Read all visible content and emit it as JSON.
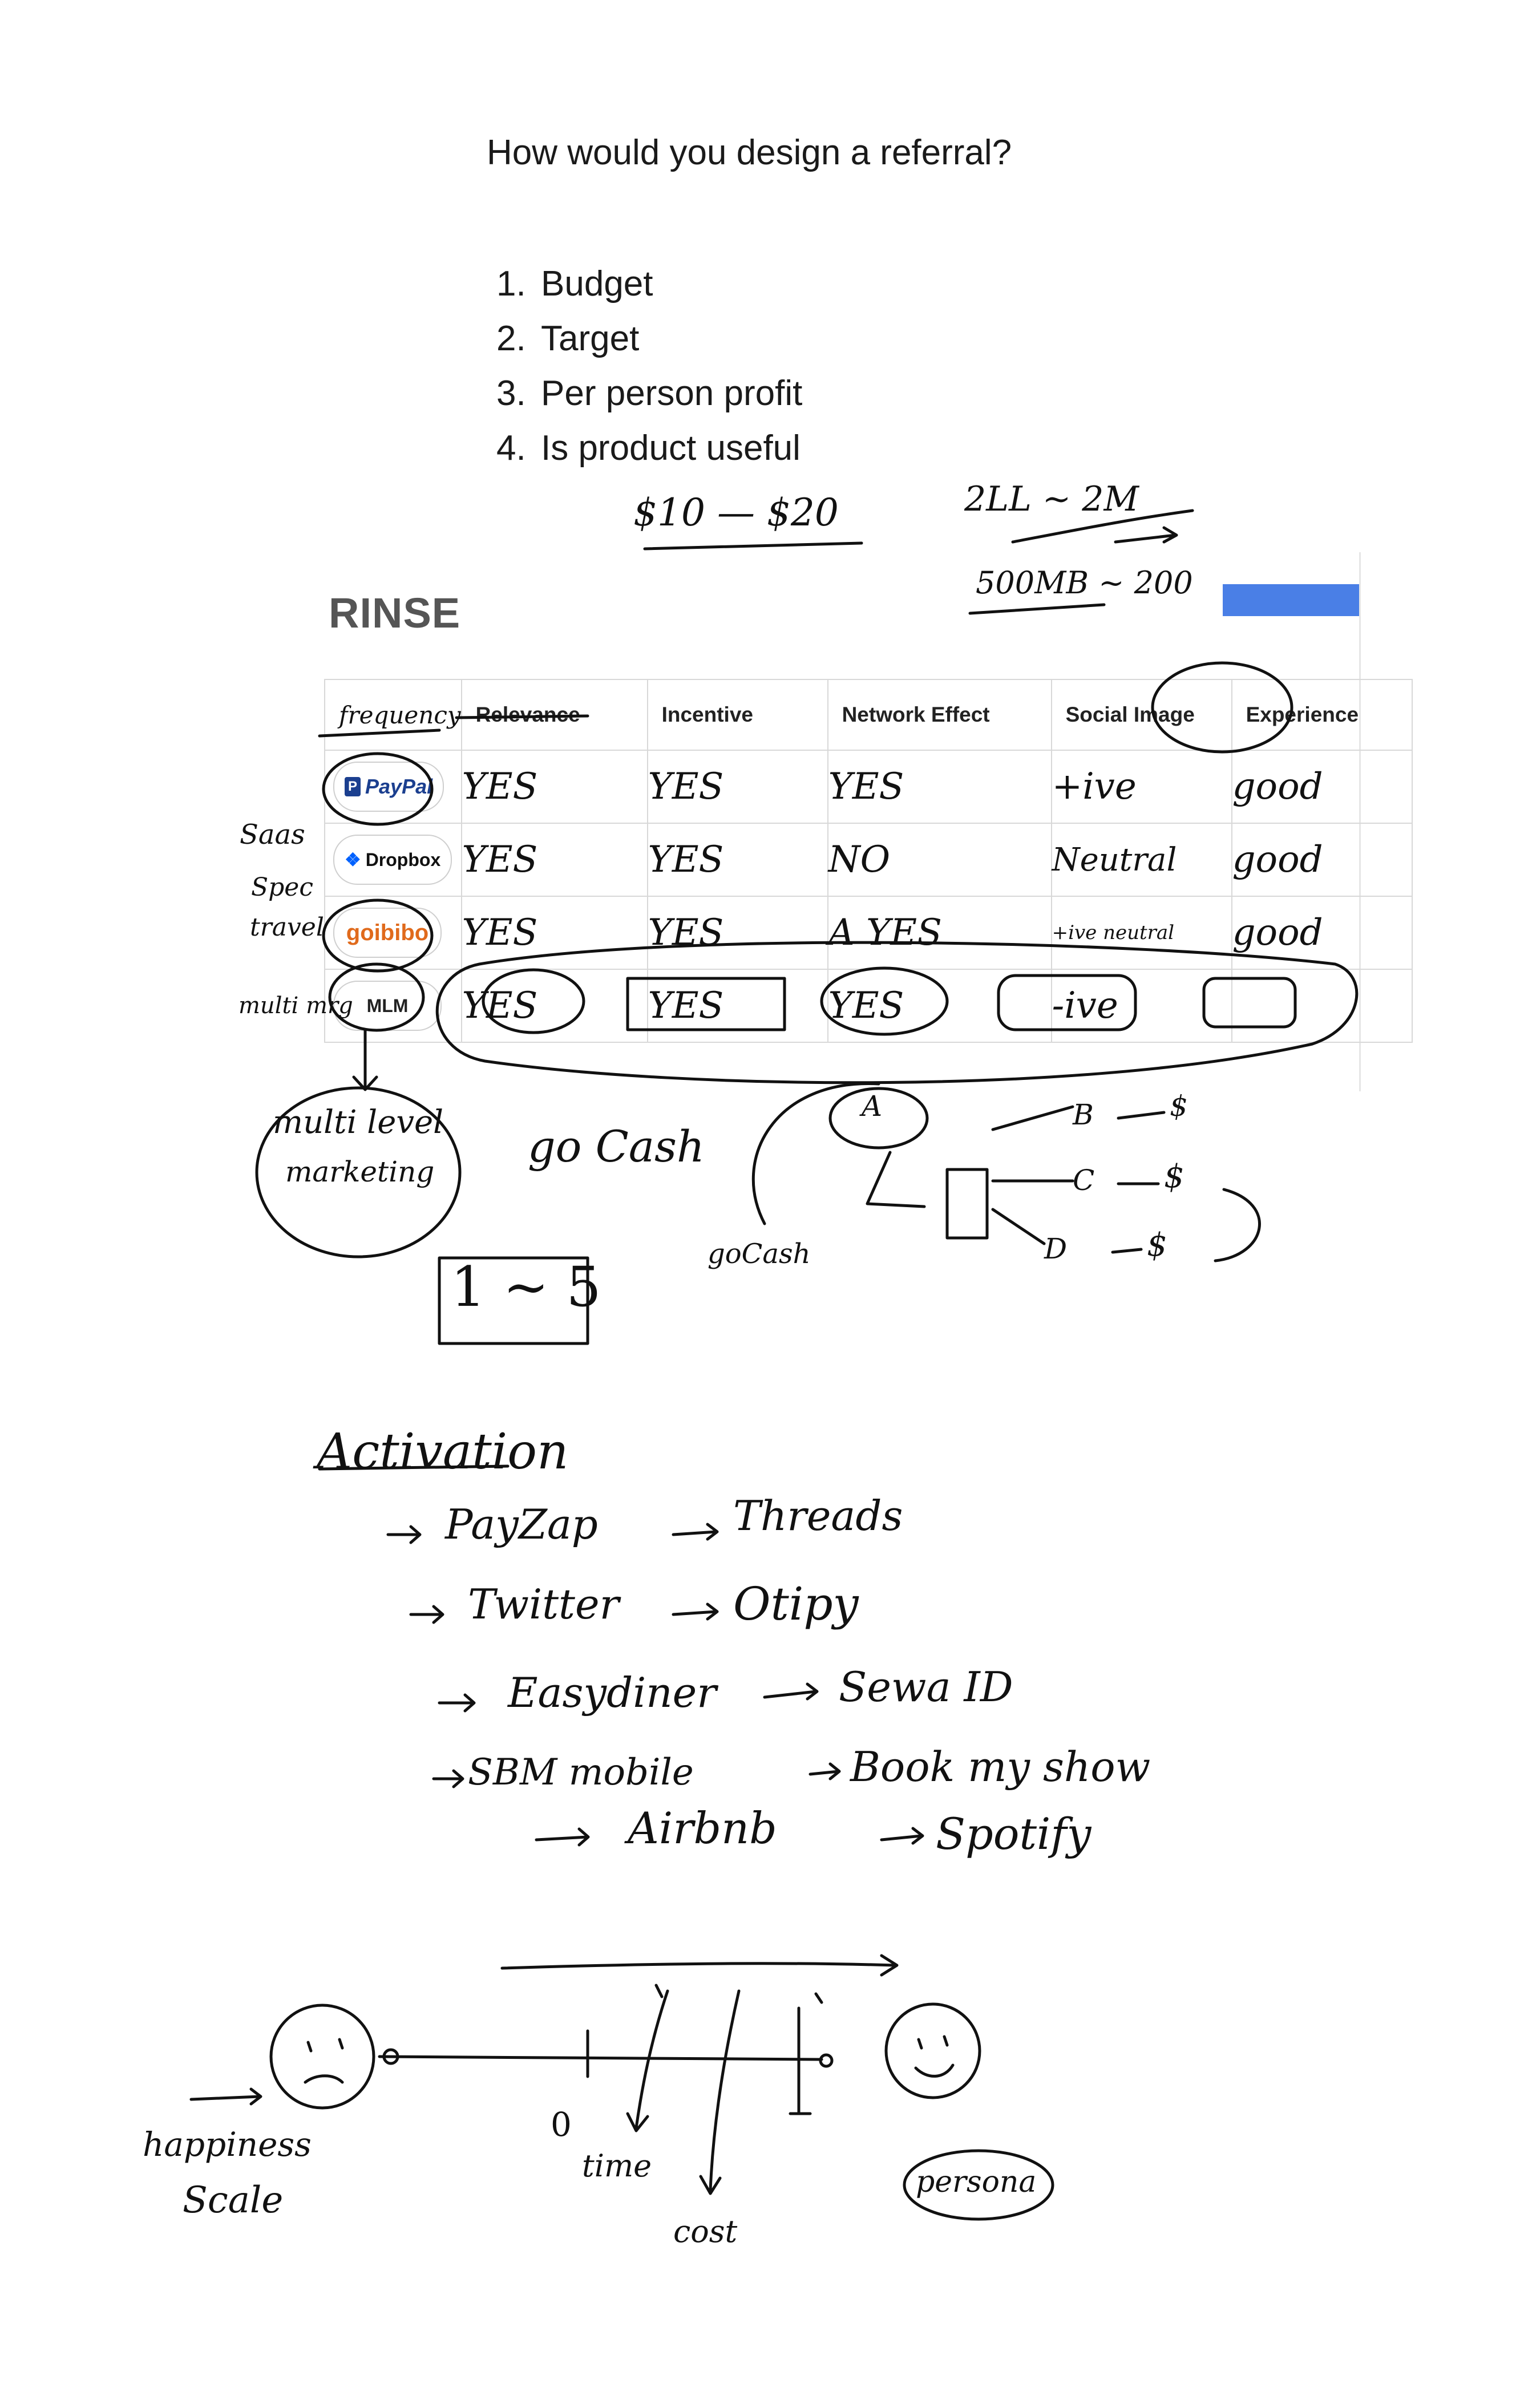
{
  "title": "How would you design a referral?",
  "questions": [
    {
      "num": "1.",
      "text": "Budget"
    },
    {
      "num": "2.",
      "text": "Target"
    },
    {
      "num": "3.",
      "text": "Per person profit"
    },
    {
      "num": "4.",
      "text": "Is product useful"
    }
  ],
  "budget_notes": {
    "range": "$10 — $20",
    "right_top": "2LL ~ 2M",
    "right_bottom": "500MB ~ 200"
  },
  "rinse": {
    "heading": "RINSE",
    "corner_note": "frequency",
    "columns": [
      "Relevance",
      "Incentive",
      "Network Effect",
      "Social Image",
      "Experience"
    ],
    "rows": [
      {
        "brand": "PayPal",
        "cells": [
          "YES",
          "YES",
          "YES",
          "+ive",
          "good"
        ]
      },
      {
        "brand": "Dropbox",
        "cells": [
          "YES",
          "YES",
          "NO",
          "Neutral",
          "good"
        ]
      },
      {
        "brand": "goibibo",
        "cells": [
          "YES",
          "YES",
          "A YES",
          "+ive neutral",
          "good"
        ]
      },
      {
        "brand": "MLM",
        "cells": [
          "YES",
          "YES",
          "YES",
          "-ive",
          ""
        ]
      }
    ],
    "side_notes": [
      "Saas",
      "Spec",
      "travel",
      "multi mrg"
    ]
  },
  "annotations": {
    "multilevel": [
      "multi level",
      "marketing"
    ],
    "go_cash": "go Cash",
    "go_cash_small": "goCash",
    "one_to_five": "1 ~ 5",
    "tree_nodes": [
      "A",
      "B",
      "C",
      "D"
    ],
    "dollar": "$"
  },
  "activation": {
    "heading": "Activation",
    "left": [
      "PayZap",
      "Twitter",
      "Easydiner",
      "SBM mobile",
      "Airbnb"
    ],
    "right": [
      "Threads",
      "Otipy",
      "Sewa ID",
      "Book my show",
      "Spotify"
    ]
  },
  "happiness": {
    "left_label": [
      "happiness",
      "Scale"
    ],
    "zero": "0",
    "time": "time",
    "cost": "cost",
    "persona": "persona"
  }
}
